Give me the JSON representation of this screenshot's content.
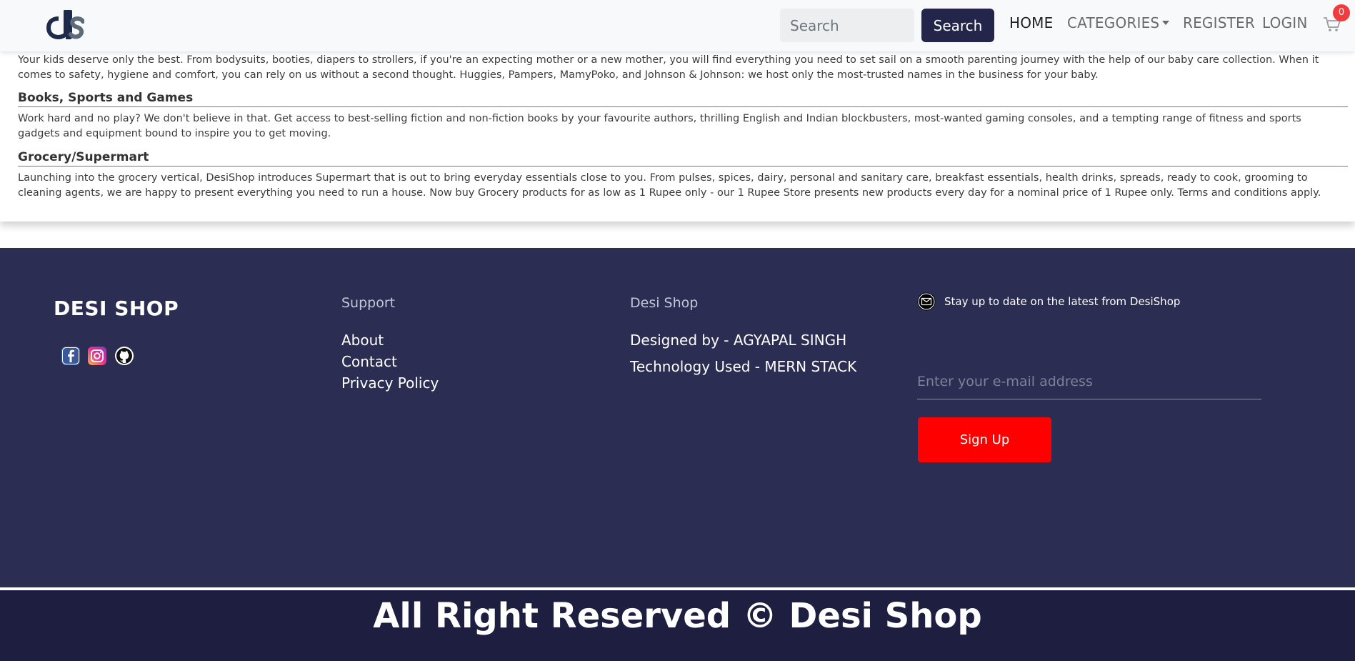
{
  "navbar": {
    "logo_icon": "ds-logo",
    "search_placeholder": "Search",
    "search_button": "Search",
    "links": {
      "home": "HOME",
      "categories": "CATEGORIES",
      "register": "REGISTER",
      "login": "LOGIN"
    },
    "cart_icon": "cart-icon",
    "cart_count": "0"
  },
  "content": {
    "baby_text": "Your kids deserve only the best. From bodysuits, booties, diapers to strollers, if you're an expecting mother or a new mother, you will find everything you need to set sail on a smooth parenting journey with the help of our baby care collection. When it comes to safety, hygiene and comfort, you can rely on us without a second thought. Huggies, Pampers, MamyPoko, and Johnson & Johnson: we host only the most-trusted names in the business for your baby.",
    "books_heading": "Books, Sports and Games",
    "books_text": "Work hard and no play? We don't believe in that. Get access to best-selling fiction and non-fiction books by your favourite authors, thrilling English and Indian blockbusters, most-wanted gaming consoles, and a tempting range of fitness and sports gadgets and equipment bound to inspire you to get moving.",
    "grocery_heading": "Grocery/Supermart",
    "grocery_text": "Launching into the grocery vertical, DesiShop introduces Supermart that is out to bring everyday essentials close to you. From pulses, spices, dairy, personal and sanitary care, breakfast essentials, health drinks, spreads, ready to cook, grooming to cleaning agents, we are happy to present everything you need to run a house. Now buy Grocery products for as low as 1 Rupee only - our 1 Rupee Store presents new products every day for a nominal price of 1 Rupee only. Terms and conditions apply."
  },
  "footer": {
    "brand": "DESI SHOP",
    "social_icons": [
      "facebook-icon",
      "instagram-icon",
      "github-icon"
    ],
    "support": {
      "title": "Support",
      "links": [
        "About",
        "Contact",
        "Privacy Policy"
      ]
    },
    "desishop": {
      "title": "Desi Shop",
      "designed_by": "Designed by - AGYAPAL SINGH",
      "technology": "Technology Used - MERN STACK"
    },
    "newsletter": {
      "icon": "mail-icon",
      "text": "Stay up to date on the latest from DesiShop",
      "email_placeholder": "Enter your e-mail address",
      "signup_button": "Sign Up"
    },
    "copyright": "All Right Reserved © Desi Shop"
  },
  "colors": {
    "navbar_bg": "#f8f9fa",
    "search_button_bg": "#23264a",
    "footer_bg": "#2c2d52",
    "bottom_bar_bg": "#1e1f40",
    "signup_bg": "#ff0000",
    "cart_badge": "#f03c3c"
  }
}
